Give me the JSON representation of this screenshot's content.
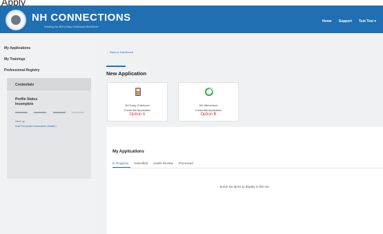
{
  "caption": "Apply",
  "header": {
    "brand": "NH CONNECTIONS",
    "tagline": "Working for NH's Early Childhood Workforce",
    "nav": {
      "home": "Home",
      "support": "Support",
      "user": "Test Test ▾"
    }
  },
  "sidebar": {
    "items": [
      {
        "label": "My Applications"
      },
      {
        "label": "My Trainings"
      },
      {
        "label": "Professional Registry"
      }
    ],
    "credentials": {
      "title": "Credentials",
      "profile_status_label": "Profile Status",
      "profile_status_value": "Incomplete",
      "next_up_label": "Next up",
      "next_up_link": "Add Personal Information details ›"
    }
  },
  "main": {
    "back_link": "← Back to Dashboard",
    "section_title": "New Application",
    "cards": [
      {
        "line1": "NH Early Childhood",
        "line2": "Credential Application",
        "option": "Option A"
      },
      {
        "line1": "NH Afterschool",
        "line2": "Credential Application",
        "option": "Option B"
      }
    ],
    "my_applications": {
      "title": "My Applications",
      "tabs": [
        "In Progress",
        "Submitted",
        "Under Review",
        "Processed"
      ],
      "empty_message": "Sorry! No items to display in this list."
    }
  },
  "colors": {
    "brand_blue": "#1f6fb2",
    "option_red": "#d33333"
  }
}
